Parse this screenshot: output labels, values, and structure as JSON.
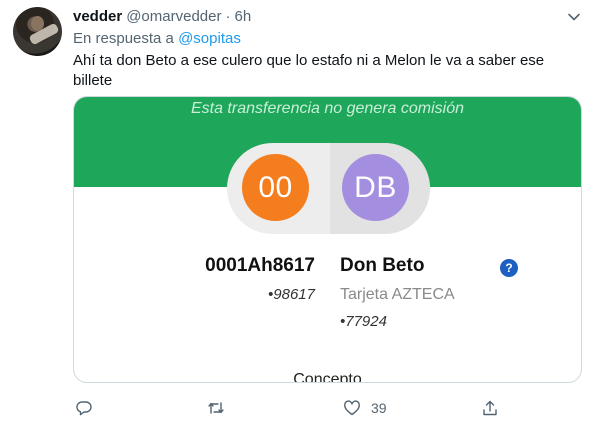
{
  "tweet": {
    "name": "vedder",
    "handle": "@omarvedder",
    "separator": "·",
    "time": "6h",
    "reply_prefix": "En respuesta a",
    "reply_to": "@sopitas",
    "text": "Ahí ta don Beto a ese culero que lo estafo ni a Melon le va a saber ese billete"
  },
  "card": {
    "banner_text": "Esta transferencia no genera comisión",
    "from_initials": "00",
    "to_initials": "DB",
    "from_account": "0001Ah8617",
    "from_masked": "•98617",
    "to_name": "Don Beto",
    "to_bank": "Tarjeta AZTECA",
    "to_masked": "•77924",
    "help_symbol": "?",
    "concept_label": "Concepto"
  },
  "actions": {
    "like_count": "39"
  },
  "icons": [
    "caret-down-icon",
    "reply-icon",
    "retweet-icon",
    "like-icon",
    "share-icon",
    "help-icon"
  ],
  "colors": {
    "banner": "#1ea65a",
    "from_circle": "#f47d1e",
    "to_circle": "#a38ee0",
    "link": "#1d9bf0"
  }
}
